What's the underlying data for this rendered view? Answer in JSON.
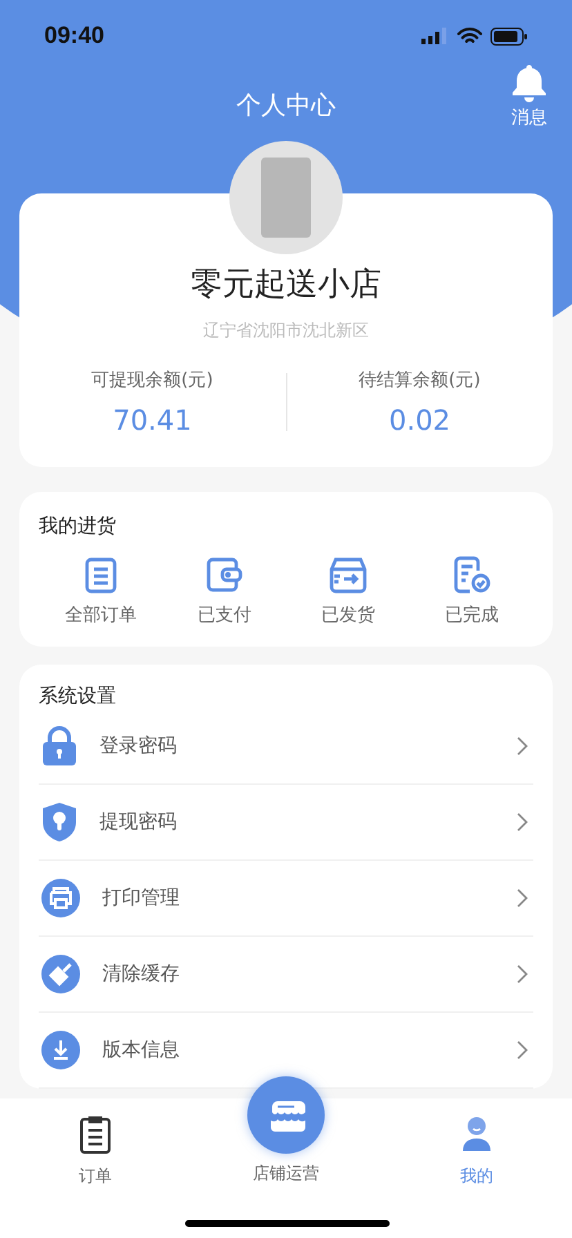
{
  "status_bar": {
    "time": "09:40"
  },
  "header": {
    "title": "个人中心",
    "message_label": "消息"
  },
  "profile": {
    "shop_name": "零元起送小店",
    "address": "辽宁省沈阳市沈北新区",
    "balances": [
      {
        "label": "可提现余额(元)",
        "value": "70.41"
      },
      {
        "label": "待结算余额(元)",
        "value": "0.02"
      }
    ]
  },
  "purchases": {
    "title": "我的进货",
    "items": [
      {
        "label": "全部订单"
      },
      {
        "label": "已支付"
      },
      {
        "label": "已发货"
      },
      {
        "label": "已完成"
      }
    ]
  },
  "settings": {
    "title": "系统设置",
    "items": [
      {
        "label": "登录密码"
      },
      {
        "label": "提现密码"
      },
      {
        "label": "打印管理"
      },
      {
        "label": "清除缓存"
      },
      {
        "label": "版本信息"
      }
    ]
  },
  "tab_bar": [
    {
      "label": "订单",
      "kind": "normal",
      "selected": false
    },
    {
      "label": "店铺运营",
      "kind": "center",
      "selected": false
    },
    {
      "label": "我的",
      "kind": "normal",
      "selected": true
    }
  ]
}
